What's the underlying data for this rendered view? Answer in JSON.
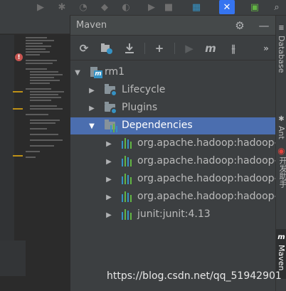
{
  "maven": {
    "title": "Maven",
    "tree": [
      {
        "label": "rm1",
        "expanded": true,
        "icon": "maven-project-icon"
      },
      {
        "label": "Lifecycle",
        "expanded": false,
        "icon": "lifecycle-folder-icon"
      },
      {
        "label": "Plugins",
        "expanded": false,
        "icon": "plugins-folder-icon"
      },
      {
        "label": "Dependencies",
        "expanded": true,
        "selected": true,
        "icon": "dependencies-folder-icon"
      },
      {
        "label": "org.apache.hadoop:hadoop-c",
        "expanded": false,
        "icon": "library-icon"
      },
      {
        "label": "org.apache.hadoop:hadoop-c",
        "expanded": false,
        "icon": "library-icon"
      },
      {
        "label": "org.apache.hadoop:hadoop-h",
        "expanded": false,
        "icon": "library-icon"
      },
      {
        "label": "org.apache.hadoop:hadoop-n",
        "expanded": false,
        "icon": "library-icon"
      },
      {
        "label": "junit:junit:4.13",
        "expanded": false,
        "icon": "library-icon"
      }
    ],
    "toolbar": {
      "icons": [
        "reimport-icon",
        "generate-sources-icon",
        "download-icon",
        "add-icon",
        "run-icon",
        "execute-goal-icon",
        "skip-tests-icon",
        "more-icon"
      ]
    }
  },
  "right_strip": {
    "database_label": "Database",
    "ant_label": "Ant",
    "chinese_label": "开发助手",
    "maven_label": "Maven"
  },
  "watermark": "https://blog.csdn.net/qq_51942901",
  "colors": {
    "selection": "#4b6eaf",
    "panel_bg": "#3c3f41",
    "editor_bg": "#2b2b2b",
    "library_bars": [
      "#3592c4",
      "#62b543",
      "#3592c4"
    ]
  }
}
